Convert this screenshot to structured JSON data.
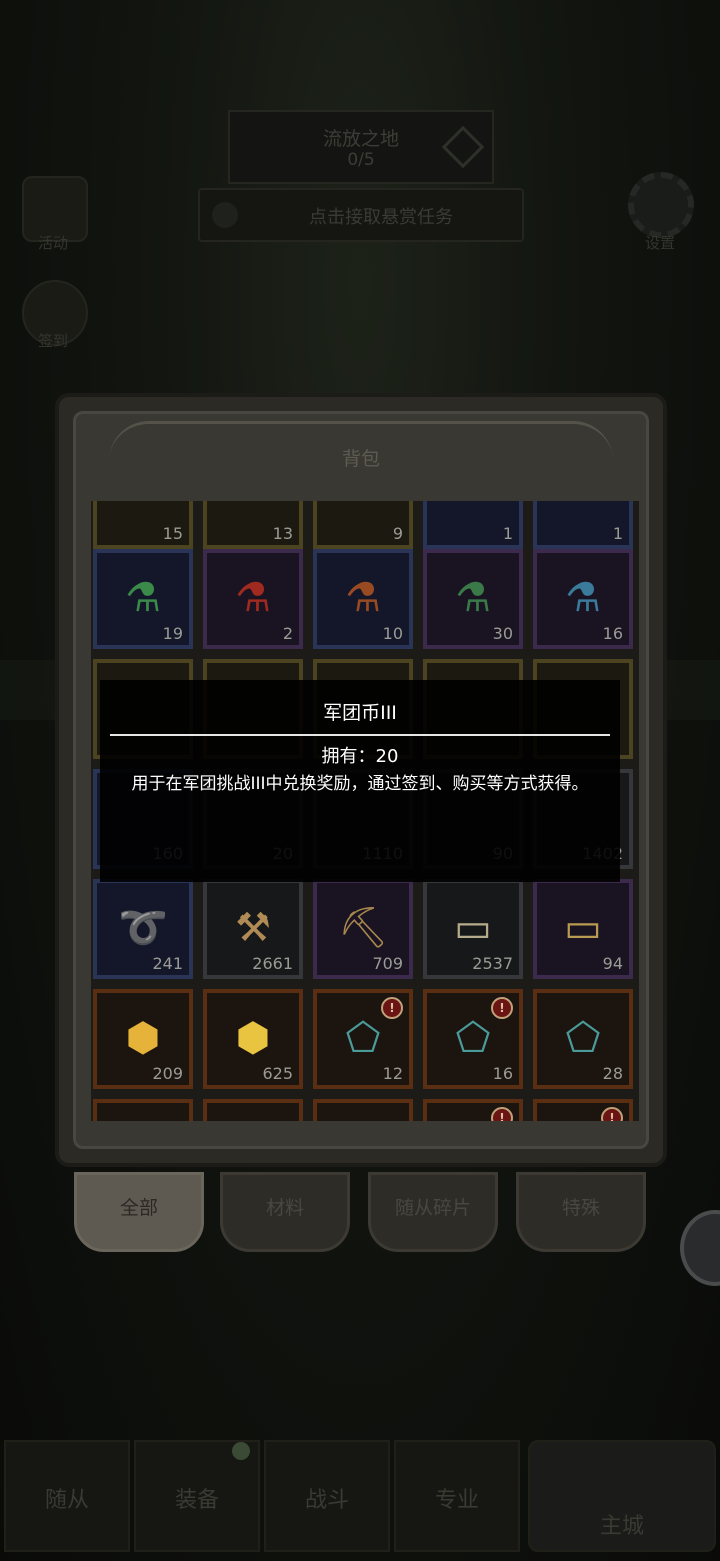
{
  "quest": {
    "title": "流放之地",
    "progress": "0/5"
  },
  "bounty": {
    "label": "点击接取悬赏任务"
  },
  "side": {
    "events": "活动",
    "signin": "签到",
    "settings": "设置"
  },
  "panel": {
    "title": "背包"
  },
  "grid": {
    "row0": [
      "15",
      "13",
      "9",
      "1",
      "1"
    ],
    "row1": [
      "19",
      "2",
      "10",
      "30",
      "16"
    ],
    "row3": [
      "160",
      "20",
      "1110",
      "90",
      "1402"
    ],
    "row4": [
      "241",
      "2661",
      "709",
      "2537",
      "94"
    ],
    "row5": [
      "209",
      "625",
      "12",
      "16",
      "28"
    ]
  },
  "tabs": [
    "全部",
    "材料",
    "随从碎片",
    "特殊"
  ],
  "nav": [
    "随从",
    "装备",
    "战斗",
    "专业",
    "主城"
  ],
  "tooltip": {
    "title": "军团币III",
    "owned": "拥有：20",
    "description": "用于在军团挑战III中兑换奖励，通过签到、购买等方式获得。"
  },
  "icons": {
    "potion": "potion-icon",
    "rope": "rope-icon",
    "hammer": "hammer-icon",
    "pickaxe": "pickaxe-icon",
    "anvil": "anvil-icon",
    "ore": "gold-ore-icon",
    "crystal": "crystal-icon",
    "alert": "alert-icon",
    "gear": "gear-icon"
  },
  "colors": {
    "accent": "#c0a27a",
    "alert": "#6a1414",
    "tooltip_bg": "#000000"
  }
}
